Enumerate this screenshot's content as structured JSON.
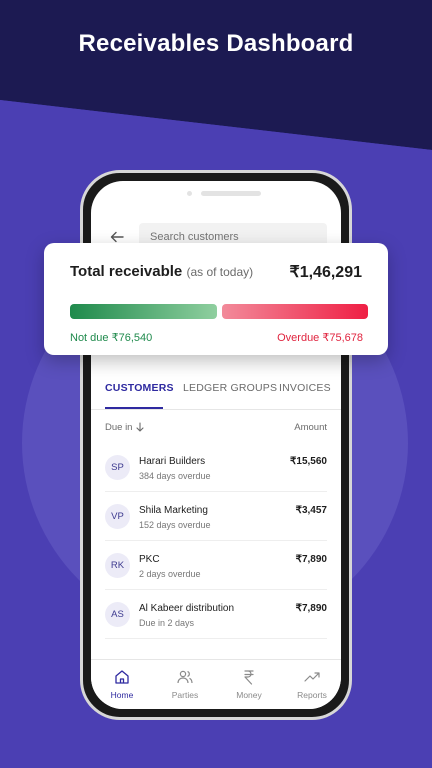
{
  "headline": "Receivables Dashboard",
  "search": {
    "placeholder": "Search customers"
  },
  "summary": {
    "title": "Total receivable",
    "subtitle": "(as of today)",
    "total": "₹1,46,291",
    "not_due": "Not due ₹76,540",
    "overdue": "Overdue ₹75,678",
    "not_due_value": 76540,
    "overdue_value": 75678
  },
  "tabs": [
    {
      "label": "CUSTOMERS",
      "active": true
    },
    {
      "label": "LEDGER GROUPS",
      "active": false
    },
    {
      "label": "INVOICES",
      "active": false
    }
  ],
  "list_header": {
    "due_in": "Due in",
    "amount": "Amount"
  },
  "customers": [
    {
      "initials": "SP",
      "name": "Harari Builders",
      "status": "384 days overdue",
      "amount": "₹15,560"
    },
    {
      "initials": "VP",
      "name": "Shila Marketing",
      "status": "152 days overdue",
      "amount": "₹3,457"
    },
    {
      "initials": "RK",
      "name": "PKC",
      "status": "2 days overdue",
      "amount": "₹7,890"
    },
    {
      "initials": "AS",
      "name": "Al Kabeer distribution",
      "status": "Due in 2 days",
      "amount": "₹7,890"
    }
  ],
  "nav": [
    {
      "label": "Home",
      "icon": "home-icon",
      "active": true
    },
    {
      "label": "Parties",
      "icon": "people-icon",
      "active": false
    },
    {
      "label": "Money",
      "icon": "rupee-icon",
      "active": false
    },
    {
      "label": "Reports",
      "icon": "trend-icon",
      "active": false
    }
  ],
  "colors": {
    "background": "#4b3fb3",
    "background_dark": "#1c1a52",
    "accent": "#2f2aa0",
    "not_due": "#1f8a4c",
    "overdue": "#e0243f"
  }
}
